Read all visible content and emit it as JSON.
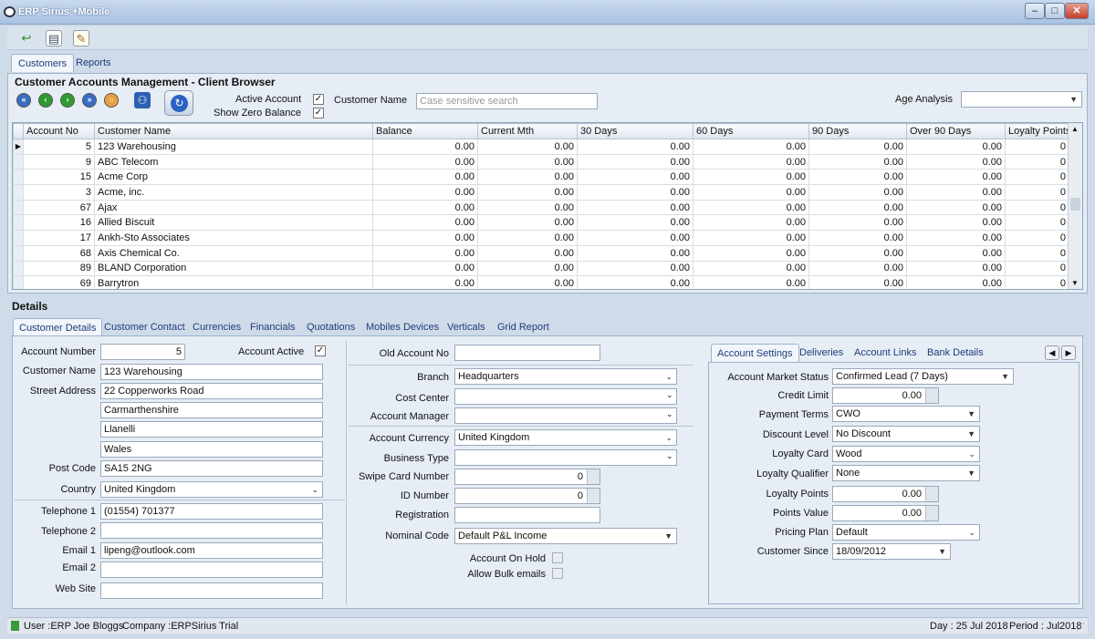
{
  "window": {
    "title": "ERP Sirius +Mobile",
    "min": "–",
    "max": "□",
    "close": "✕"
  },
  "toolbar": {
    "icons": [
      "back-arrow-icon",
      "new-document-icon",
      "edit-document-icon"
    ]
  },
  "top_tabs": [
    "Customers",
    "Reports"
  ],
  "browser": {
    "title": "Customer Accounts Management - Client Browser",
    "active_account_label": "Active Account",
    "show_zero_label": "Show Zero Balance",
    "customer_name_label": "Customer Name",
    "customer_name_placeholder": "Case sensitive search",
    "age_analysis_label": "Age Analysis",
    "columns": [
      "Account No",
      "Customer Name",
      "Balance",
      "Current Mth",
      "30 Days",
      "60 Days",
      "90 Days",
      "Over 90 Days",
      "Loyalty Points"
    ],
    "rows": [
      [
        "5",
        "123 Warehousing",
        "0.00",
        "0.00",
        "0.00",
        "0.00",
        "0.00",
        "0.00",
        "0"
      ],
      [
        "9",
        "ABC Telecom",
        "0.00",
        "0.00",
        "0.00",
        "0.00",
        "0.00",
        "0.00",
        "0"
      ],
      [
        "15",
        "Acme Corp",
        "0.00",
        "0.00",
        "0.00",
        "0.00",
        "0.00",
        "0.00",
        "0"
      ],
      [
        "3",
        "Acme, inc.",
        "0.00",
        "0.00",
        "0.00",
        "0.00",
        "0.00",
        "0.00",
        "0"
      ],
      [
        "67",
        "Ajax",
        "0.00",
        "0.00",
        "0.00",
        "0.00",
        "0.00",
        "0.00",
        "0"
      ],
      [
        "16",
        "Allied Biscuit",
        "0.00",
        "0.00",
        "0.00",
        "0.00",
        "0.00",
        "0.00",
        "0"
      ],
      [
        "17",
        "Ankh-Sto Associates",
        "0.00",
        "0.00",
        "0.00",
        "0.00",
        "0.00",
        "0.00",
        "0"
      ],
      [
        "68",
        "Axis Chemical Co.",
        "0.00",
        "0.00",
        "0.00",
        "0.00",
        "0.00",
        "0.00",
        "0"
      ],
      [
        "89",
        "BLAND Corporation",
        "0.00",
        "0.00",
        "0.00",
        "0.00",
        "0.00",
        "0.00",
        "0"
      ],
      [
        "69",
        "Barrytron",
        "0.00",
        "0.00",
        "0.00",
        "0.00",
        "0.00",
        "0.00",
        "0"
      ]
    ]
  },
  "details": {
    "title": "Details",
    "tabs": [
      "Customer Details",
      "Customer Contact",
      "Currencies",
      "Financials",
      "Quotations",
      "Mobiles Devices",
      "Verticals",
      "Grid Report"
    ],
    "left": {
      "account_number_label": "Account Number",
      "account_number": "5",
      "account_active_label": "Account Active",
      "customer_name_label": "Customer Name",
      "customer_name": "123 Warehousing",
      "street_label": "Street Address",
      "street1": "22 Copperworks Road",
      "street2": "Carmarthenshire",
      "street3": "Llanelli",
      "street4": "Wales",
      "post_code_label": "Post Code",
      "post_code": "SA15 2NG",
      "country_label": "Country",
      "country": "United Kingdom",
      "tel1_label": "Telephone 1",
      "tel1": "(01554) 701377",
      "tel2_label": "Telephone 2",
      "tel2": "",
      "email1_label": "Email 1",
      "email1": "lipeng@outlook.com",
      "email2_label": "Email 2",
      "email2": "",
      "web_label": "Web Site",
      "web": ""
    },
    "middle": {
      "old_account_label": "Old Account No",
      "old_account": "",
      "branch_label": "Branch",
      "branch": "Headquarters",
      "cost_center_label": "Cost Center",
      "cost_center": "",
      "account_manager_label": "Account Manager",
      "account_manager": "",
      "currency_label": "Account Currency",
      "currency": "United Kingdom",
      "business_type_label": "Business Type",
      "business_type": "",
      "swipe_label": "Swipe Card Number",
      "swipe": "0",
      "id_label": "ID Number",
      "id": "0",
      "registration_label": "Registration",
      "registration": "",
      "nominal_label": "Nominal Code",
      "nominal": "Default P&L Income",
      "on_hold_label": "Account On Hold",
      "bulk_label": "Allow Bulk emails"
    },
    "right": {
      "tabs": [
        "Account Settings",
        "Deliveries",
        "Account Links",
        "Bank Details"
      ],
      "market_status_label": "Account Market Status",
      "market_status": "Confirmed Lead (7 Days)",
      "credit_limit_label": "Credit Limit",
      "credit_limit": "0.00",
      "payment_terms_label": "Payment Terms",
      "payment_terms": "CWO",
      "discount_label": "Discount Level",
      "discount": "No Discount",
      "loyalty_card_label": "Loyalty Card",
      "loyalty_card": "Wood",
      "loyalty_qual_label": "Loyalty Qualifier",
      "loyalty_qual": "None",
      "loyalty_points_label": "Loyalty Points",
      "loyalty_points": "0.00",
      "points_value_label": "Points Value",
      "points_value": "0.00",
      "pricing_label": "Pricing Plan",
      "pricing": "Default",
      "since_label": "Customer Since",
      "since": "18/09/2012"
    }
  },
  "status": {
    "user": "User :ERP Joe Bloggs",
    "company": "Company :ERPSirius Trial",
    "day": "Day : 25 Jul 2018",
    "period": "Period : Jul2018"
  }
}
